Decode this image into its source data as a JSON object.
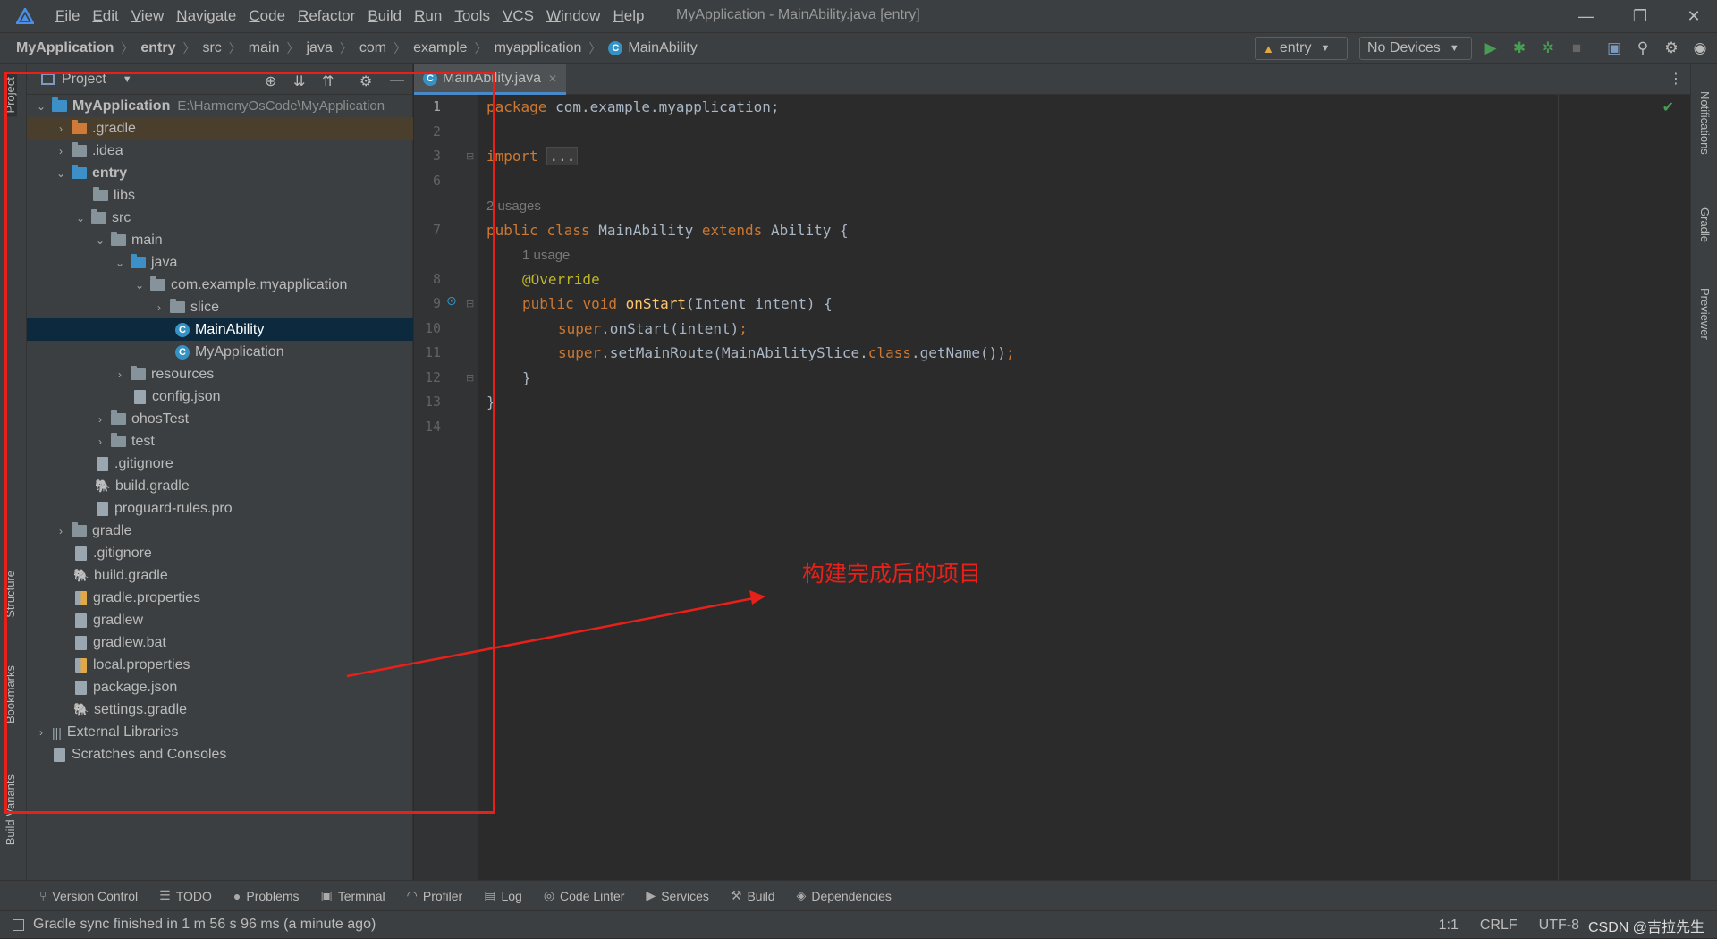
{
  "app": {
    "window_title": "MyApplication - MainAbility.java [entry]",
    "menu": [
      "File",
      "Edit",
      "View",
      "Navigate",
      "Code",
      "Refactor",
      "Build",
      "Run",
      "Tools",
      "VCS",
      "Window",
      "Help"
    ]
  },
  "breadcrumb": [
    "MyApplication",
    "entry",
    "src",
    "main",
    "java",
    "com",
    "example",
    "myapplication",
    "MainAbility"
  ],
  "toolbar": {
    "module_combo": "entry",
    "device_combo": "No Devices"
  },
  "left_stripe": {
    "project": "Project",
    "structure": "Structure",
    "bookmarks": "Bookmarks",
    "build_variants": "Build Variants"
  },
  "project_panel": {
    "title": "Project",
    "root_label": "MyApplication",
    "root_path": "E:\\HarmonyOsCode\\MyApplication",
    "rows": [
      {
        "label": ".gradle"
      },
      {
        "label": ".idea"
      },
      {
        "label": "entry"
      },
      {
        "label": "libs"
      },
      {
        "label": "src"
      },
      {
        "label": "main"
      },
      {
        "label": "java"
      },
      {
        "label": "com.example.myapplication"
      },
      {
        "label": "slice"
      },
      {
        "label": "MainAbility"
      },
      {
        "label": "MyApplication"
      },
      {
        "label": "resources"
      },
      {
        "label": "config.json"
      },
      {
        "label": "ohosTest"
      },
      {
        "label": "test"
      },
      {
        "label": ".gitignore"
      },
      {
        "label": "build.gradle"
      },
      {
        "label": "proguard-rules.pro"
      },
      {
        "label": "gradle"
      },
      {
        "label": ".gitignore"
      },
      {
        "label": "build.gradle"
      },
      {
        "label": "gradle.properties"
      },
      {
        "label": "gradlew"
      },
      {
        "label": "gradlew.bat"
      },
      {
        "label": "local.properties"
      },
      {
        "label": "package.json"
      },
      {
        "label": "settings.gradle"
      },
      {
        "label": "External Libraries"
      },
      {
        "label": "Scratches and Consoles"
      }
    ]
  },
  "editor": {
    "tab_label": "MainAbility.java",
    "line_numbers": [
      "1",
      "2",
      "3",
      "6",
      "7",
      "8",
      "9",
      "10",
      "11",
      "12",
      "13",
      "14"
    ],
    "hints": {
      "usages_class": "2 usages",
      "usages_method": "1 usage"
    },
    "code": {
      "l1_kw": "package",
      "l1_rest": " com.example.myapplication;",
      "l3_kw": "import",
      "l3_fold": "...",
      "l7_kw1": "public",
      "l7_kw2": "class",
      "l7_name": "MainAbility",
      "l7_kw3": "extends",
      "l7_rest": "Ability {",
      "l8_ann": "@Override",
      "l9_kw1": "public",
      "l9_kw2": "void",
      "l9_fn": "onStart",
      "l9_rest": "(Intent intent) {",
      "l10_kw": "super",
      "l10_rest": ".onStart(intent)",
      "l10_semi": ";",
      "l11_kw": "super",
      "l11_rest1": ".setMainRoute(MainAbilitySlice.",
      "l11_kw2": "class",
      "l11_rest2": ".getName())",
      "l11_semi": ";",
      "l12": "}",
      "l13": "}"
    }
  },
  "right_stripe": {
    "notifications": "Notifications",
    "gradle": "Gradle",
    "previewer": "Previewer"
  },
  "bottom_tools": [
    "Version Control",
    "TODO",
    "Problems",
    "Terminal",
    "Profiler",
    "Log",
    "Code Linter",
    "Services",
    "Build",
    "Dependencies"
  ],
  "status": {
    "message": "Gradle sync finished in 1 m 56 s 96 ms (a minute ago)",
    "position": "1:1",
    "line_sep": "CRLF",
    "encoding": "UTF-8",
    "watermark": "CSDN @吉拉先生"
  },
  "annotation": {
    "text": "构建完成后的项目",
    "color": "#e8201a"
  },
  "colors": {
    "accent": "#4a88c7",
    "selection": "#0d293e",
    "keyword": "#cc7832",
    "annotation": "#bbb529",
    "method": "#ffc66d"
  }
}
